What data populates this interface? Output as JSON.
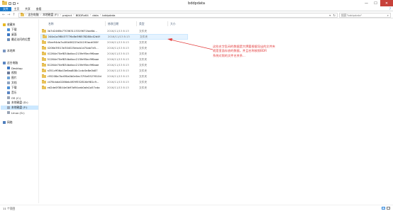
{
  "window": {
    "title": "bddpdata",
    "controls": {
      "minimize": "—",
      "maximize": "☐",
      "close": "✕"
    }
  },
  "ribbon": {
    "tabs": [
      "文件",
      "主页",
      "共享",
      "查看"
    ],
    "help": "?"
  },
  "nav": {
    "back": "←",
    "forward": "→",
    "up": "↑",
    "breadcrumbs": [
      "这台电脑",
      "本地磁盘 (F:)",
      "project",
      "BDDRx64",
      "data",
      "bddpdata"
    ],
    "search_placeholder": "搜索\"bddpdata\""
  },
  "sidebar": {
    "items": [
      {
        "label": "收藏夹",
        "icon": "star-icon",
        "color": "#e8b923"
      },
      {
        "label": "下载",
        "icon": "download-folder-icon",
        "color": "#4a8fd6"
      },
      {
        "label": "桌面",
        "icon": "desktop-icon",
        "color": "#3b77c4"
      },
      {
        "label": "最近访问的位置",
        "icon": "recent-icon",
        "color": "#6f8fb8"
      },
      {
        "label": "本地库",
        "icon": "library-icon",
        "color": "#7a96c2"
      },
      {
        "label": "这台电脑",
        "icon": "computer-icon",
        "color": "#5b86c3"
      },
      {
        "label": "Desktop",
        "icon": "desktop-folder-icon",
        "color": "#3b77c4"
      },
      {
        "label": "视频",
        "icon": "video-folder-icon",
        "color": "#6b7a99"
      },
      {
        "label": "图片",
        "icon": "pictures-folder-icon",
        "color": "#6ea3d6"
      },
      {
        "label": "文档",
        "icon": "documents-folder-icon",
        "color": "#8fa4c0"
      },
      {
        "label": "下载",
        "icon": "download-folder-icon",
        "color": "#4a8fd6"
      },
      {
        "label": "音乐",
        "icon": "music-folder-icon",
        "color": "#5b86c3"
      },
      {
        "label": "OS (C:)",
        "icon": "drive-icon",
        "color": "#9aa5b5"
      },
      {
        "label": "本地磁盘 (D:)",
        "icon": "drive-icon",
        "color": "#9aa5b5"
      },
      {
        "label": "本地磁盘 (F:)",
        "icon": "drive-icon",
        "color": "#9aa5b5"
      },
      {
        "label": "Linux (G:)",
        "icon": "drive-icon",
        "color": "#9aa5b5"
      },
      {
        "label": "网络",
        "icon": "network-icon",
        "color": "#4f7fbd"
      }
    ]
  },
  "columns": {
    "name": "名称",
    "date": "修改日期",
    "type": "类型",
    "size": "大小"
  },
  "files": [
    {
      "name": "0b7d2465b770363113319671fae6d...",
      "date": "2016/11/13 8:13",
      "type": "文件夹"
    },
    {
      "name": "044a1a3f8437776c8e3f6578280c42d4f",
      "date": "2016/11/13 8:13",
      "type": "文件夹"
    },
    {
      "name": "45ee94da7a4f4b56225e24190acd000f",
      "date": "2016/11/13 8:13",
      "type": "文件夹"
    },
    {
      "name": "4206e3f013e304025ebcb1d74ab7e5...",
      "date": "2016/11/13 8:13",
      "type": "文件夹"
    },
    {
      "name": "41264e70ef834bdbcc215fe95ec9f6aae",
      "date": "2016/11/13 8:13",
      "type": "文件夹"
    },
    {
      "name": "51264e70ef834bdbcc215fe95ec9f6aae",
      "date": "2016/11/13 8:13",
      "type": "文件夹"
    },
    {
      "name": "61264e70ef834bdbcc215fe95ec9f6aae",
      "date": "2016/11/13 8:13",
      "type": "文件夹"
    },
    {
      "name": "a351cff06a43e6ea808c1cdc0e8e0b87",
      "date": "2016/11/13 8:13",
      "type": "文件夹"
    },
    {
      "name": "c95208a7bc6f0a0b0e0ec37f4e5527610d",
      "date": "2016/11/13 8:13",
      "type": "文件夹"
    },
    {
      "name": "cd76cbda0286eb4f09f552816e981c9...",
      "date": "2016/11/13 8:13",
      "type": "文件夹"
    },
    {
      "name": "ed2de0f3844e0b93d94ceb0afa1a57cda",
      "date": "2016/11/13 8:13",
      "type": "文件夹"
    }
  ],
  "selected_index": 1,
  "annotation": {
    "lines": [
      "这些名字乱码的数据是大牌要根据导出的文件夹",
      "就是里面存放的数据，并且名称按照BDR",
      "系统对照的文件名关系..."
    ],
    "color": "#e23b3b"
  },
  "status": {
    "text": "11 个项目"
  }
}
